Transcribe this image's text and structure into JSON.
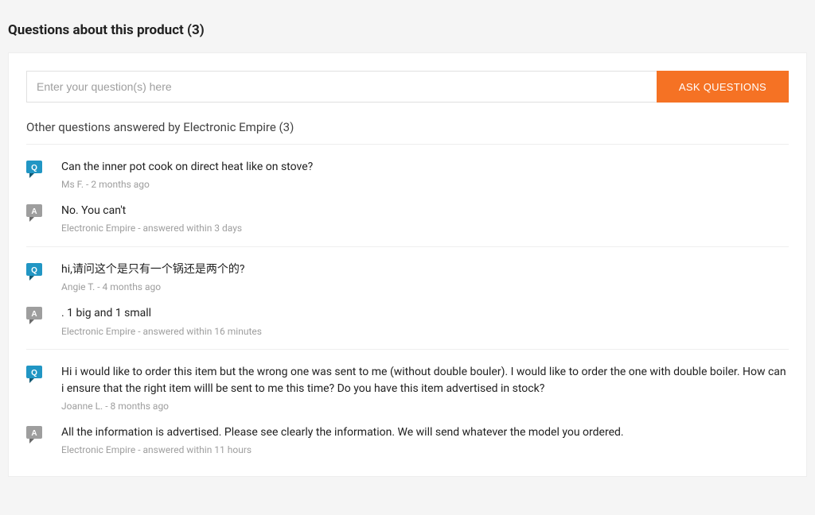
{
  "header": {
    "title_prefix": "Questions about this product",
    "count": "3"
  },
  "ask": {
    "placeholder": "Enter your question(s) here",
    "button_label": "ASK QUESTIONS"
  },
  "subhead": {
    "prefix": "Other questions answered by",
    "seller": "Electronic Empire",
    "count": "3"
  },
  "qa": [
    {
      "q": "Can the inner pot cook on direct heat like on stove?",
      "q_author": "Ms F.",
      "q_time": "2 months ago",
      "a": "No. You can't",
      "a_author": "Electronic Empire",
      "a_time": "answered within 3 days"
    },
    {
      "q": "hi,请问这个是只有一个锅还是两个的?",
      "q_author": "Angie T.",
      "q_time": "4 months ago",
      "a": ". 1 big and 1 small",
      "a_author": "Electronic Empire",
      "a_time": "answered within 16 minutes"
    },
    {
      "q": "Hi i would like to order this item but the wrong one was sent to me (without double bouler). I would like to order the one with double boiler. How can i ensure that the right item willl be sent to me this time? Do you have this item advertised in stock?",
      "q_author": "Joanne L.",
      "q_time": "8 months ago",
      "a": "All the information is advertised. Please see clearly the information. We will send whatever the model you ordered.",
      "a_author": "Electronic Empire",
      "a_time": "answered within 11 hours"
    }
  ]
}
